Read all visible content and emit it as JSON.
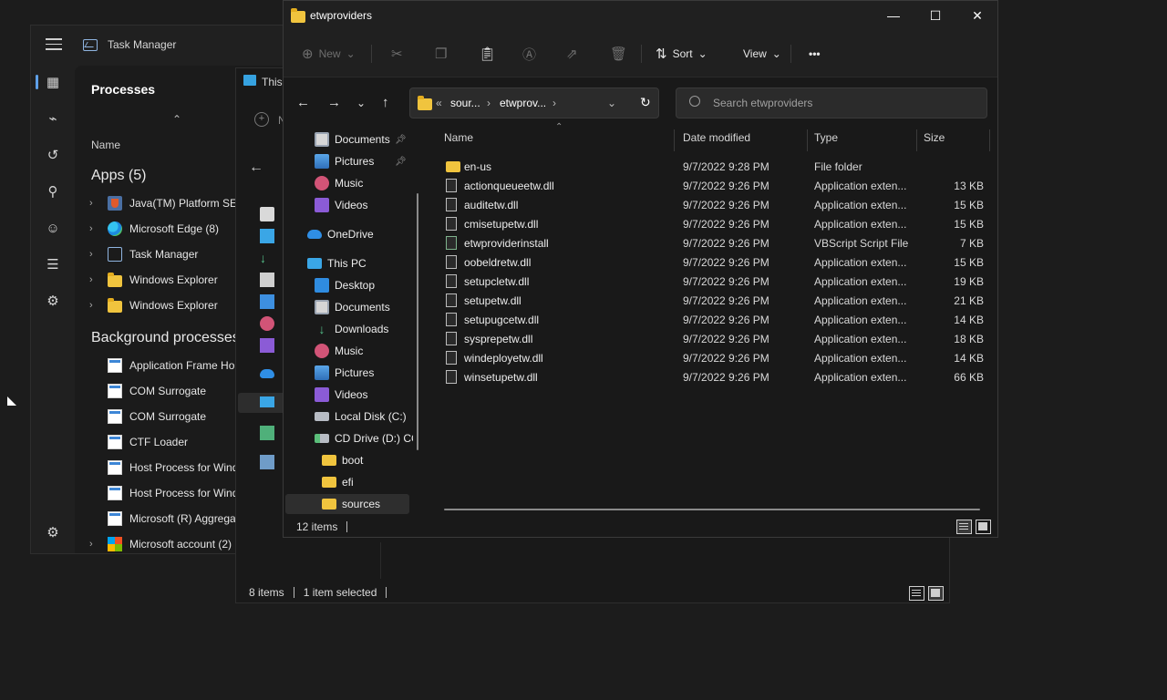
{
  "task_manager": {
    "title": "Task Manager",
    "page_title": "Processes",
    "column_name": "Name",
    "apps_header": "Apps (5)",
    "bg_header": "Background processes",
    "apps": [
      {
        "label": "Java(TM) Platform SE b",
        "icon": "java-icon"
      },
      {
        "label": "Microsoft Edge (8)",
        "icon": "edge-icon"
      },
      {
        "label": "Task Manager",
        "icon": "task-manager-icon"
      },
      {
        "label": "Windows Explorer",
        "icon": "folder-icon"
      },
      {
        "label": "Windows Explorer",
        "icon": "folder-icon"
      }
    ],
    "background": [
      {
        "label": "Application Frame Ho"
      },
      {
        "label": "COM Surrogate"
      },
      {
        "label": "COM Surrogate"
      },
      {
        "label": "CTF Loader"
      },
      {
        "label": "Host Process for Wind"
      },
      {
        "label": "Host Process for Wind"
      },
      {
        "label": "Microsoft (R) Aggrega"
      },
      {
        "label": "Microsoft account (2)"
      }
    ]
  },
  "this_pc": {
    "title": "This",
    "new_label": "N",
    "status": {
      "items": "8 items",
      "selected": "1 item selected"
    }
  },
  "explorer": {
    "title": "etwproviders",
    "toolbar": {
      "new": "New",
      "sort": "Sort",
      "view": "View",
      "more": "•••"
    },
    "address": {
      "sep": "«",
      "crumb1": "sour...",
      "crumb2": "etwprov...",
      "chev": "›"
    },
    "search_placeholder": "Search etwproviders",
    "nav": {
      "documents": "Documents",
      "pictures": "Pictures",
      "music": "Music",
      "videos": "Videos",
      "onedrive": "OneDrive",
      "this_pc": "This PC",
      "desktop": "Desktop",
      "documents2": "Documents",
      "downloads": "Downloads",
      "music2": "Music",
      "pictures2": "Pictures",
      "videos2": "Videos",
      "local_disk": "Local Disk (C:)",
      "cd_drive": "CD Drive (D:) CC",
      "boot": "boot",
      "efi": "efi",
      "sources": "sources"
    },
    "columns": {
      "name": "Name",
      "date": "Date modified",
      "type": "Type",
      "size": "Size"
    },
    "files": [
      {
        "name": "en-us",
        "date": "9/7/2022 9:28 PM",
        "type": "File folder",
        "size": ""
      },
      {
        "name": "actionqueueetw.dll",
        "date": "9/7/2022 9:26 PM",
        "type": "Application exten...",
        "size": "13 KB"
      },
      {
        "name": "auditetw.dll",
        "date": "9/7/2022 9:26 PM",
        "type": "Application exten...",
        "size": "15 KB"
      },
      {
        "name": "cmisetupetw.dll",
        "date": "9/7/2022 9:26 PM",
        "type": "Application exten...",
        "size": "15 KB"
      },
      {
        "name": "etwproviderinstall",
        "date": "9/7/2022 9:26 PM",
        "type": "VBScript Script File",
        "size": "7 KB"
      },
      {
        "name": "oobeldretw.dll",
        "date": "9/7/2022 9:26 PM",
        "type": "Application exten...",
        "size": "15 KB"
      },
      {
        "name": "setupcletw.dll",
        "date": "9/7/2022 9:26 PM",
        "type": "Application exten...",
        "size": "19 KB"
      },
      {
        "name": "setupetw.dll",
        "date": "9/7/2022 9:26 PM",
        "type": "Application exten...",
        "size": "21 KB"
      },
      {
        "name": "setupugcetw.dll",
        "date": "9/7/2022 9:26 PM",
        "type": "Application exten...",
        "size": "14 KB"
      },
      {
        "name": "sysprepetw.dll",
        "date": "9/7/2022 9:26 PM",
        "type": "Application exten...",
        "size": "18 KB"
      },
      {
        "name": "windeployetw.dll",
        "date": "9/7/2022 9:26 PM",
        "type": "Application exten...",
        "size": "14 KB"
      },
      {
        "name": "winsetupetw.dll",
        "date": "9/7/2022 9:26 PM",
        "type": "Application exten...",
        "size": "66 KB"
      }
    ],
    "status": {
      "items": "12 items"
    }
  }
}
